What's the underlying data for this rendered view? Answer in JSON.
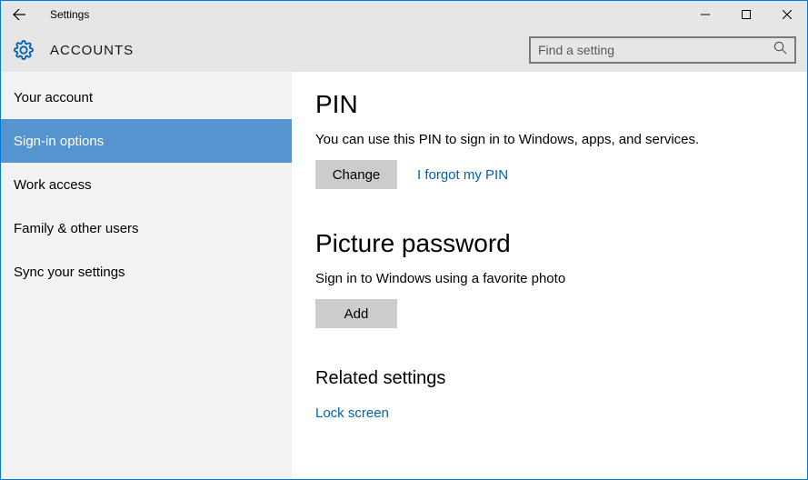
{
  "window": {
    "title": "Settings"
  },
  "header": {
    "title": "ACCOUNTS",
    "search_placeholder": "Find a setting"
  },
  "sidebar": {
    "items": [
      {
        "label": "Your account",
        "active": false
      },
      {
        "label": "Sign-in options",
        "active": true
      },
      {
        "label": "Work access",
        "active": false
      },
      {
        "label": "Family & other users",
        "active": false
      },
      {
        "label": "Sync your settings",
        "active": false
      }
    ]
  },
  "content": {
    "pin": {
      "heading": "PIN",
      "description": "You can use this PIN to sign in to Windows, apps, and services.",
      "change_btn": "Change",
      "forgot_link": "I forgot my PIN"
    },
    "picture": {
      "heading": "Picture password",
      "description": "Sign in to Windows using a favorite photo",
      "add_btn": "Add"
    },
    "related": {
      "heading": "Related settings",
      "lock_screen_link": "Lock screen"
    }
  }
}
